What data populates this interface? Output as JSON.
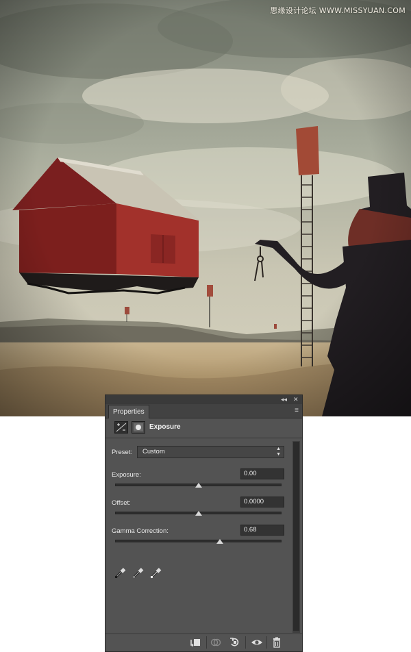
{
  "watermark": {
    "text": "思缘设计论坛 WWW.MISSYUAN.COM"
  },
  "panel": {
    "tab_label": "Properties",
    "title": "Exposure",
    "preset": {
      "label": "Preset:",
      "value": "Custom"
    },
    "sliders": [
      {
        "label": "Exposure:",
        "value": "0.00",
        "position": 0.5
      },
      {
        "label": "Offset:",
        "value": "0.0000",
        "position": 0.5
      },
      {
        "label": "Gamma Correction:",
        "value": "0.68",
        "position": 0.63
      }
    ],
    "titlebar_buttons": {
      "collapse": "◂◂",
      "close": "✕"
    },
    "menu_icon": "≡"
  },
  "icons": {
    "header": [
      "exposure-adjustment-icon",
      "layer-mask-icon"
    ],
    "droppers": [
      "black-point-eyedropper-icon",
      "gray-point-eyedropper-icon",
      "white-point-eyedropper-icon"
    ],
    "footer": [
      "clip-to-layer-icon",
      "view-previous-state-icon",
      "reset-icon",
      "visibility-eye-icon",
      "trash-icon"
    ]
  }
}
